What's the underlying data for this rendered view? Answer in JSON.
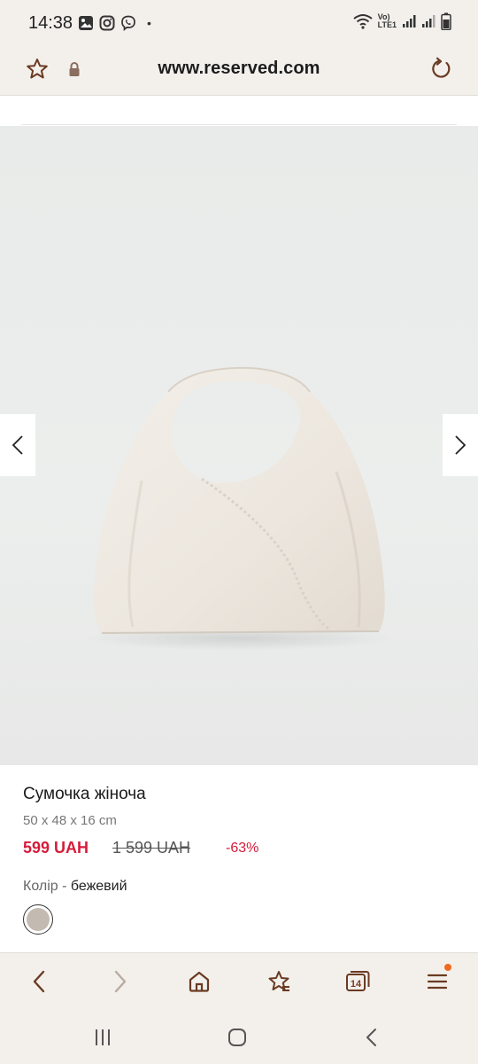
{
  "status_bar": {
    "time": "14:38",
    "network_label_top": "Vo)",
    "network_label_bottom": "LTE1"
  },
  "url_bar": {
    "url": "www.reserved.com",
    "icons": [
      "star-icon",
      "lock-icon",
      "reload-icon"
    ]
  },
  "product": {
    "name": "Сумочка жіноча",
    "dimensions": "50 x 48 x 16 cm",
    "price_current": "599 UAH",
    "price_old": "1 599 UAH",
    "discount": "-63%",
    "color_label": "Колір - ",
    "color_value": "бежевий",
    "swatch_color": "#c3bab1",
    "image": {
      "background": "#eaeceb",
      "bag_color": "#efeae3"
    }
  },
  "browser_toolbar": {
    "tabs_count": "14",
    "icons": [
      "back-icon",
      "forward-icon",
      "home-icon",
      "bookmark-star-icon",
      "tabs-icon",
      "menu-icon"
    ],
    "accent_color": "#7a3b22",
    "notification_color": "#f06a1c"
  },
  "system_nav": {
    "icons": [
      "recents-icon",
      "home-icon",
      "back-icon"
    ]
  }
}
